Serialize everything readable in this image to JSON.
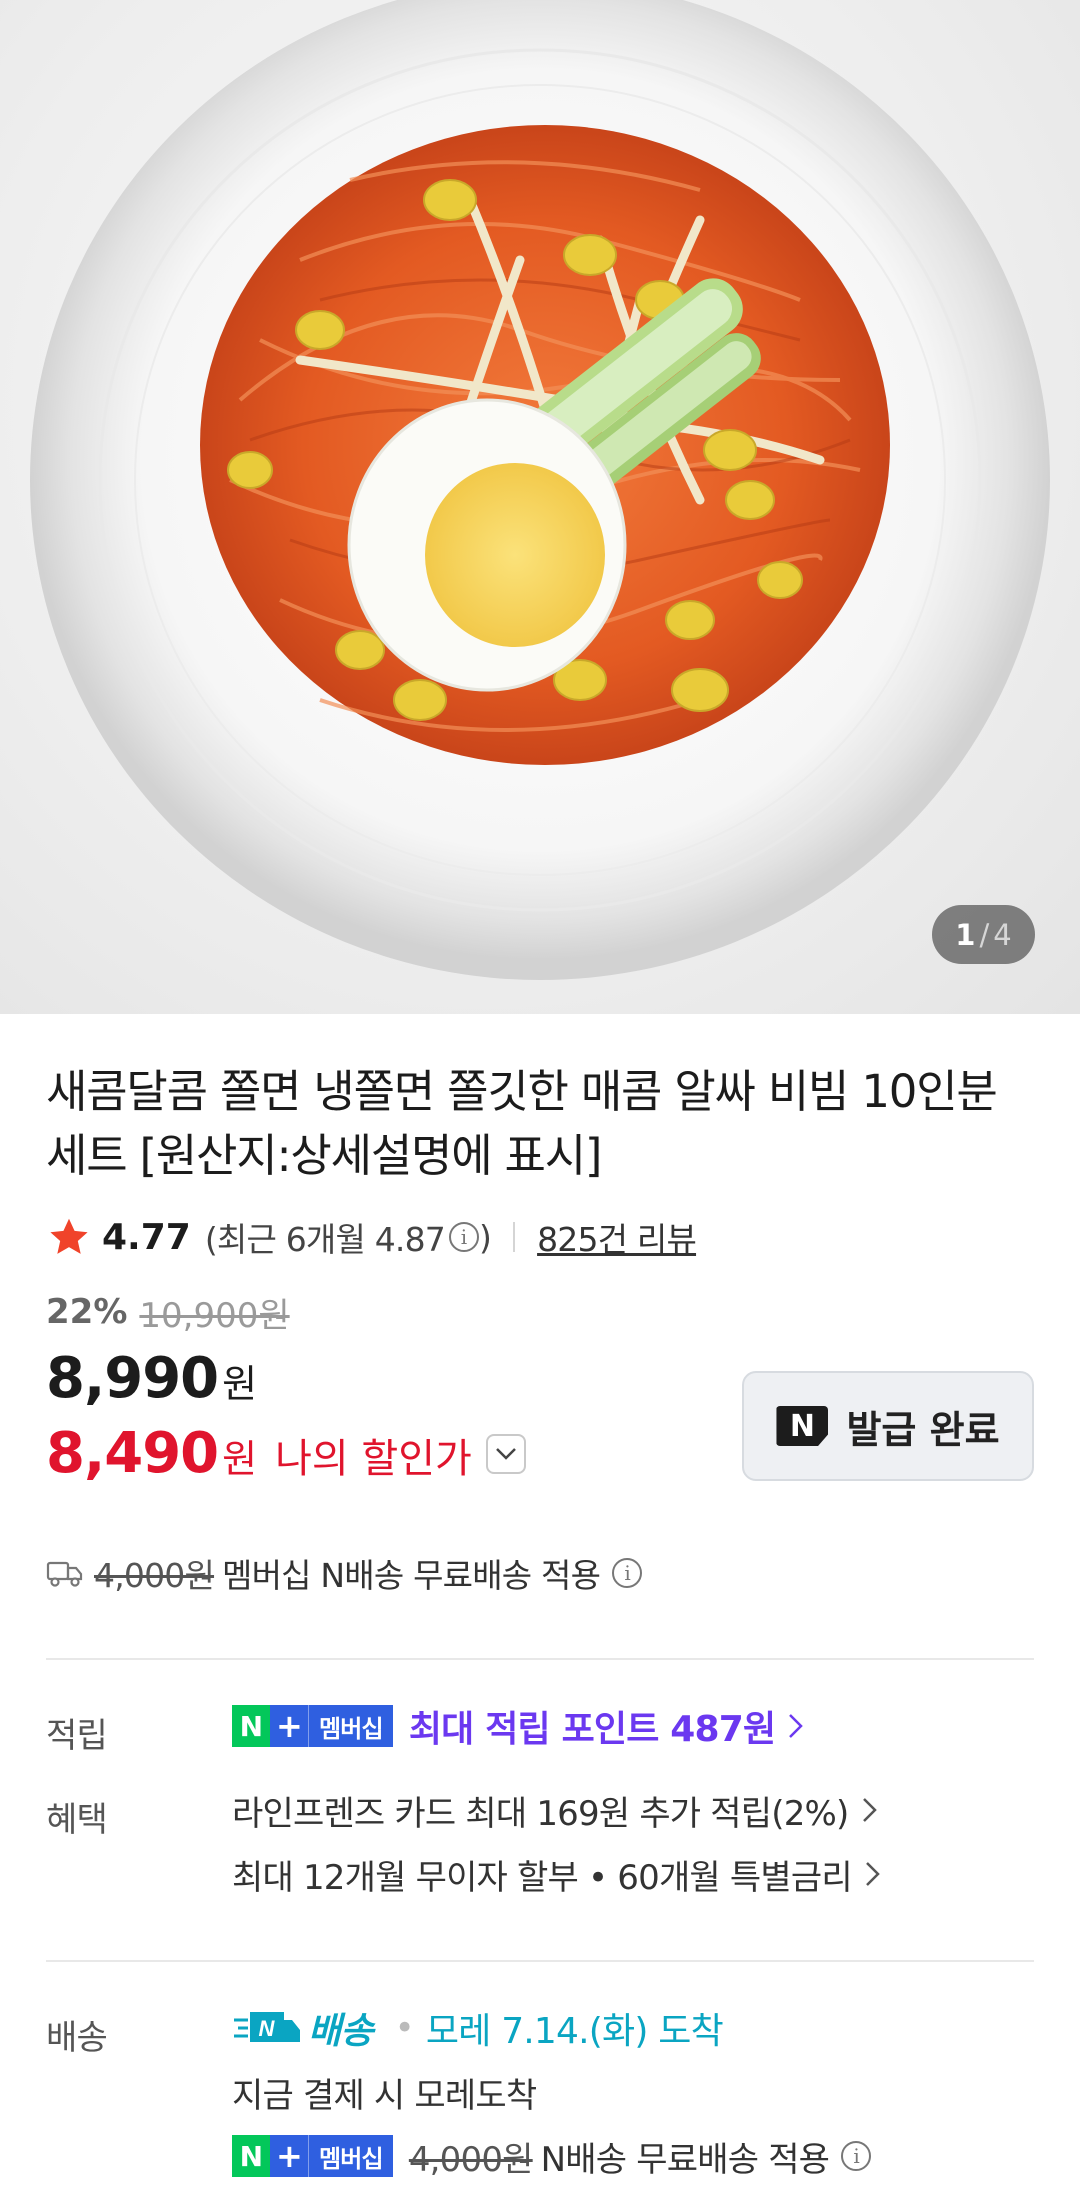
{
  "gallery": {
    "current": "1",
    "separator": "/",
    "total": "4"
  },
  "product": {
    "title": "새콤달콤 쫄면 냉쫄면 쫄깃한 매콤 알싸 비빔 10인분 세트 [원산지:상세설명에 표시]",
    "rating": "4.77",
    "recent_rating": "(최근 6개월 4.87",
    "recent_rating_close": ")",
    "reviews": "825건 리뷰"
  },
  "price": {
    "discount_rate": "22%",
    "original": "10,900원",
    "sale": "8,990",
    "sale_unit": "원",
    "my_price": "8,490",
    "my_unit": "원",
    "my_label": "나의 할인가"
  },
  "coupon": {
    "badge": "N",
    "label": "발급 완료"
  },
  "shipping_summary": {
    "struck_fee": "4,000원",
    "text": "멤버십 N배송 무료배송 적용"
  },
  "points": {
    "label": "적립",
    "badge_n": "N",
    "badge_plus": "+",
    "badge_text": "멤버십",
    "text": "최대 적립 포인트 487원"
  },
  "benefits": {
    "label": "혜택",
    "card": "라인프렌즈 카드 최대 169원 추가 적립(2%)",
    "installment": "최대 12개월 무이자 할부 • 60개월 특별금리"
  },
  "delivery": {
    "label": "배송",
    "service": "배송",
    "arrival": "모레 7.14.(화) 도착",
    "note": "지금 결제 시 모레도착",
    "struck_fee": "4,000원",
    "free_text": "N배송 무료배송 적용"
  },
  "colors": {
    "accent_red": "#e0142d",
    "naver_green": "#03c75a",
    "membership_blue": "#2f5fe0",
    "point_purple": "#6b38f0",
    "delivery_teal": "#0aa5c2"
  }
}
